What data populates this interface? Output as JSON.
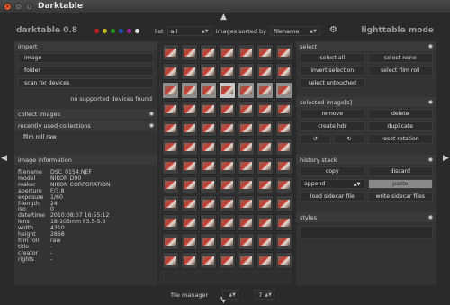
{
  "window": {
    "title": "Darktable"
  },
  "header": {
    "app_version": "darktable 0.8",
    "mode": "lighttable mode",
    "color_dots": [
      "#c02020",
      "#c8c020",
      "#20a020",
      "#2050c0",
      "#a020a0",
      "#e8e8e8"
    ],
    "filter": {
      "list_label": "list",
      "list_value": "all",
      "sort_label": "images sorted by",
      "sort_value": "filename"
    }
  },
  "left": {
    "import": {
      "title": "import",
      "buttons": [
        "image",
        "folder",
        "scan for devices"
      ],
      "note": "no supported devices found"
    },
    "collect_images": {
      "title": "collect images"
    },
    "recent": {
      "title": "recently used collections",
      "items": [
        "film roll raw"
      ]
    },
    "image_info": {
      "title": "image information",
      "rows": [
        {
          "k": "filename",
          "v": "DSC_0154.NEF"
        },
        {
          "k": "model",
          "v": "NIKON D90"
        },
        {
          "k": "maker",
          "v": "NIKON CORPORATION"
        },
        {
          "k": "aperture",
          "v": "F/3.8"
        },
        {
          "k": "exposure",
          "v": "1/60"
        },
        {
          "k": "f-length",
          "v": "24"
        },
        {
          "k": "iso",
          "v": "0"
        },
        {
          "k": "date/time",
          "v": "2010:08:07 16:55:12"
        },
        {
          "k": "lens",
          "v": "18-105mm F3.5-5.6"
        },
        {
          "k": "width",
          "v": "4310"
        },
        {
          "k": "height",
          "v": "2868"
        },
        {
          "k": "film roll",
          "v": "raw"
        },
        {
          "k": "title",
          "v": "-"
        },
        {
          "k": "creator",
          "v": "-"
        },
        {
          "k": "rights",
          "v": "-"
        }
      ]
    }
  },
  "right": {
    "select": {
      "title": "select",
      "buttons": [
        "select all",
        "select none",
        "invert selection",
        "select film roll",
        "select untouched"
      ]
    },
    "selected": {
      "title": "selected image[s]",
      "buttons": [
        "remove",
        "delete",
        "create hdr",
        "duplicate",
        "reset rotation"
      ]
    },
    "history": {
      "title": "history stack",
      "copy": "copy",
      "discard": "discard",
      "append": "append",
      "paste": "paste",
      "load": "load sidecar file",
      "write": "write sidecar files"
    },
    "styles": {
      "title": "styles"
    }
  },
  "footer": {
    "view_label": "file manager",
    "zoom_value": "7"
  }
}
